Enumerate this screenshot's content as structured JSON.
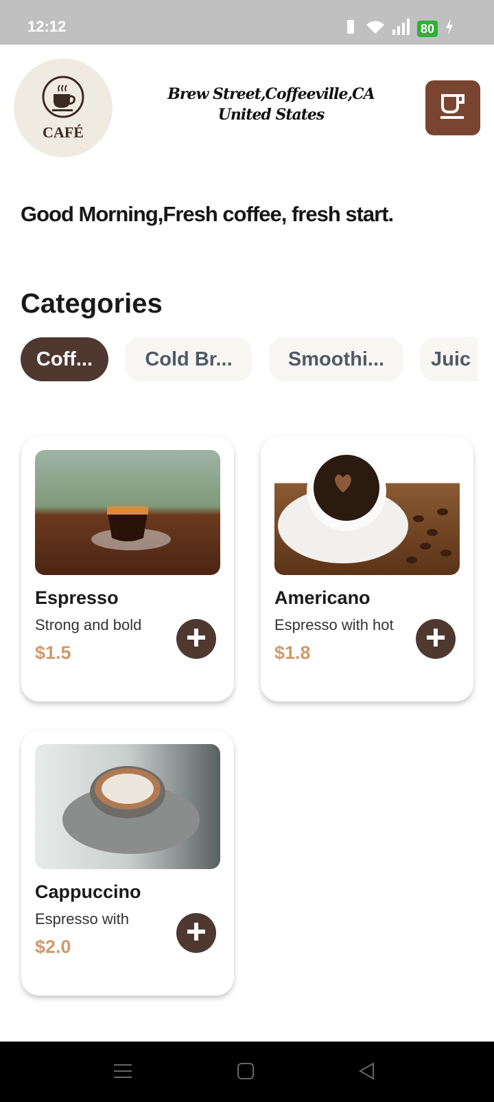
{
  "status_bar": {
    "time": "12:12",
    "battery": "80"
  },
  "header": {
    "logo_text": "CAFÉ",
    "address_line1": "Brew Street,Coffeeville,CA",
    "address_line2": "United States"
  },
  "greeting": "Good Morning,Fresh coffee, fresh start.",
  "categories": {
    "title": "Categories",
    "items": [
      {
        "label": "Coff...",
        "active": true
      },
      {
        "label": "Cold Br...",
        "active": false
      },
      {
        "label": "Smoothi...",
        "active": false
      },
      {
        "label": "Juic",
        "active": false
      }
    ]
  },
  "products": [
    {
      "name": "Espresso",
      "desc": "Strong and bold",
      "price": "$1.5"
    },
    {
      "name": "Americano",
      "desc": "Espresso with hot",
      "price": "$1.8"
    },
    {
      "name": "Cappuccino",
      "desc": "Espresso with",
      "price": "$2.0"
    }
  ],
  "colors": {
    "accent": "#4e3830",
    "cart": "#7a4530",
    "price": "#d09a6c"
  }
}
